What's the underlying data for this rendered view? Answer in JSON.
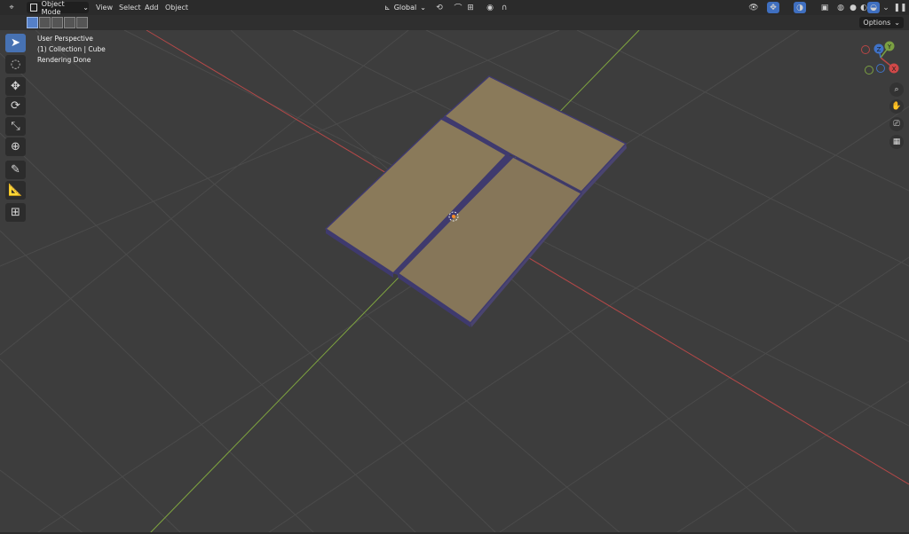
{
  "header": {
    "mode_label": "Object Mode",
    "menus": [
      "View",
      "Select",
      "Add",
      "Object"
    ],
    "transform_orientation": "Global",
    "options_label": "Options"
  },
  "overlay": {
    "perspective": "User Perspective",
    "collection": "(1) Collection | Cube",
    "status": "Rendering Done"
  },
  "gizmo": {
    "x": "X",
    "y": "Y",
    "z": "Z"
  },
  "colors": {
    "x_axis": "#c94a4a",
    "y_axis": "#8ab34a",
    "plane_face": "#8a7a5a",
    "plane_edge": "#3f3a6e",
    "grid": "#4a4a4a",
    "viewport_bg": "#3d3d3d"
  },
  "tools": [
    "select-box",
    "cursor",
    "move",
    "rotate",
    "scale",
    "transform",
    "annotate",
    "measure",
    "add-cube"
  ]
}
